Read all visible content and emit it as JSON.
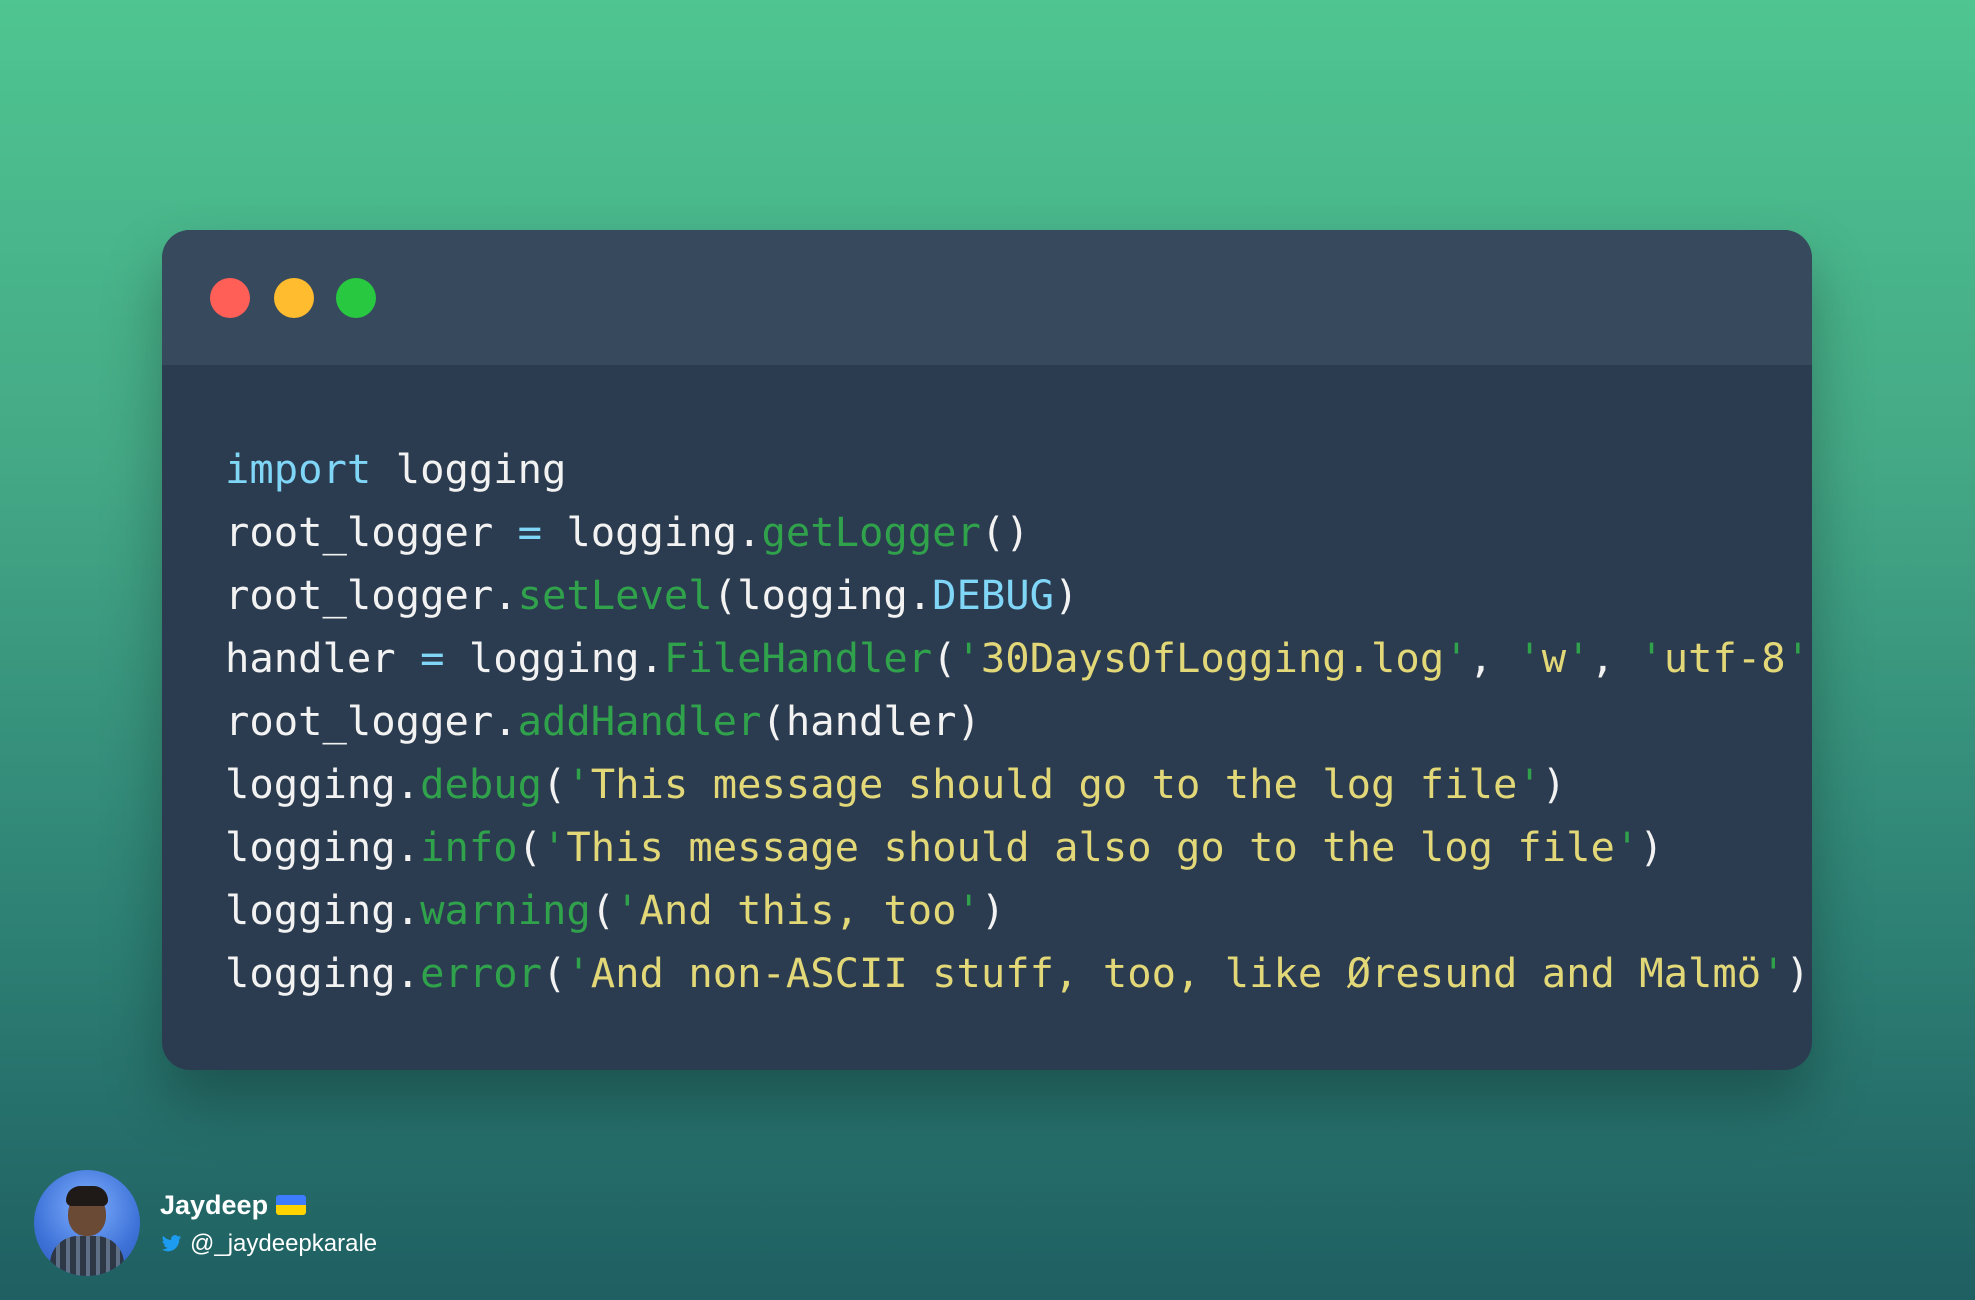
{
  "window": {
    "buttons": [
      {
        "name": "close",
        "color": "#ff5f57"
      },
      {
        "name": "minimize",
        "color": "#febc2e"
      },
      {
        "name": "maximize",
        "color": "#28c840"
      }
    ],
    "code_lines": [
      [
        {
          "text": "import",
          "cls": "kw"
        },
        {
          "text": " logging",
          "cls": "plain"
        }
      ],
      [
        {
          "text": "root_logger ",
          "cls": "plain"
        },
        {
          "text": "=",
          "cls": "op"
        },
        {
          "text": " logging.",
          "cls": "plain"
        },
        {
          "text": "getLogger",
          "cls": "fn"
        },
        {
          "text": "()",
          "cls": "plain"
        }
      ],
      [
        {
          "text": "root_logger.",
          "cls": "plain"
        },
        {
          "text": "setLevel",
          "cls": "fn"
        },
        {
          "text": "(logging.",
          "cls": "plain"
        },
        {
          "text": "DEBUG",
          "cls": "const"
        },
        {
          "text": ")",
          "cls": "plain"
        }
      ],
      [
        {
          "text": "handler ",
          "cls": "plain"
        },
        {
          "text": "=",
          "cls": "op"
        },
        {
          "text": " logging.",
          "cls": "plain"
        },
        {
          "text": "FileHandler",
          "cls": "fn"
        },
        {
          "text": "(",
          "cls": "plain"
        },
        {
          "text": "'",
          "cls": "quote"
        },
        {
          "text": "30DaysOfLogging.log",
          "cls": "str"
        },
        {
          "text": "'",
          "cls": "quote"
        },
        {
          "text": ", ",
          "cls": "plain"
        },
        {
          "text": "'",
          "cls": "quote"
        },
        {
          "text": "w",
          "cls": "str"
        },
        {
          "text": "'",
          "cls": "quote"
        },
        {
          "text": ", ",
          "cls": "plain"
        },
        {
          "text": "'",
          "cls": "quote"
        },
        {
          "text": "utf-8",
          "cls": "str"
        },
        {
          "text": "'",
          "cls": "quote"
        },
        {
          "text": ")",
          "cls": "plain"
        }
      ],
      [
        {
          "text": "root_logger.",
          "cls": "plain"
        },
        {
          "text": "addHandler",
          "cls": "fn"
        },
        {
          "text": "(handler)",
          "cls": "plain"
        }
      ],
      [
        {
          "text": "logging.",
          "cls": "plain"
        },
        {
          "text": "debug",
          "cls": "fn"
        },
        {
          "text": "(",
          "cls": "plain"
        },
        {
          "text": "'",
          "cls": "quote"
        },
        {
          "text": "This message should go to the log file",
          "cls": "str"
        },
        {
          "text": "'",
          "cls": "quote"
        },
        {
          "text": ")",
          "cls": "plain"
        }
      ],
      [
        {
          "text": "logging.",
          "cls": "plain"
        },
        {
          "text": "info",
          "cls": "fn"
        },
        {
          "text": "(",
          "cls": "plain"
        },
        {
          "text": "'",
          "cls": "quote"
        },
        {
          "text": "This message should also go to the log file",
          "cls": "str"
        },
        {
          "text": "'",
          "cls": "quote"
        },
        {
          "text": ")",
          "cls": "plain"
        }
      ],
      [
        {
          "text": "logging.",
          "cls": "plain"
        },
        {
          "text": "warning",
          "cls": "fn"
        },
        {
          "text": "(",
          "cls": "plain"
        },
        {
          "text": "'",
          "cls": "quote"
        },
        {
          "text": "And this, too",
          "cls": "str"
        },
        {
          "text": "'",
          "cls": "quote"
        },
        {
          "text": ")",
          "cls": "plain"
        }
      ],
      [
        {
          "text": "logging.",
          "cls": "plain"
        },
        {
          "text": "error",
          "cls": "fn"
        },
        {
          "text": "(",
          "cls": "plain"
        },
        {
          "text": "'",
          "cls": "quote"
        },
        {
          "text": "And non-ASCII stuff, too, like Øresund and Malmö",
          "cls": "str"
        },
        {
          "text": "'",
          "cls": "quote"
        },
        {
          "text": ")",
          "cls": "plain"
        }
      ]
    ]
  },
  "author": {
    "name": "Jaydeep",
    "flag_icon": "ukraine-flag-icon",
    "platform_icon": "twitter-icon",
    "handle": "@_jaydeepkarale"
  },
  "colors": {
    "background_top": "#4fc591",
    "background_bottom": "#1f5f62",
    "window_body": "#2c3c50",
    "window_titlebar": "#37495c",
    "keyword": "#7fd6f6",
    "function": "#2fa24b",
    "string": "#e3d878",
    "text": "#f2f2f2"
  }
}
